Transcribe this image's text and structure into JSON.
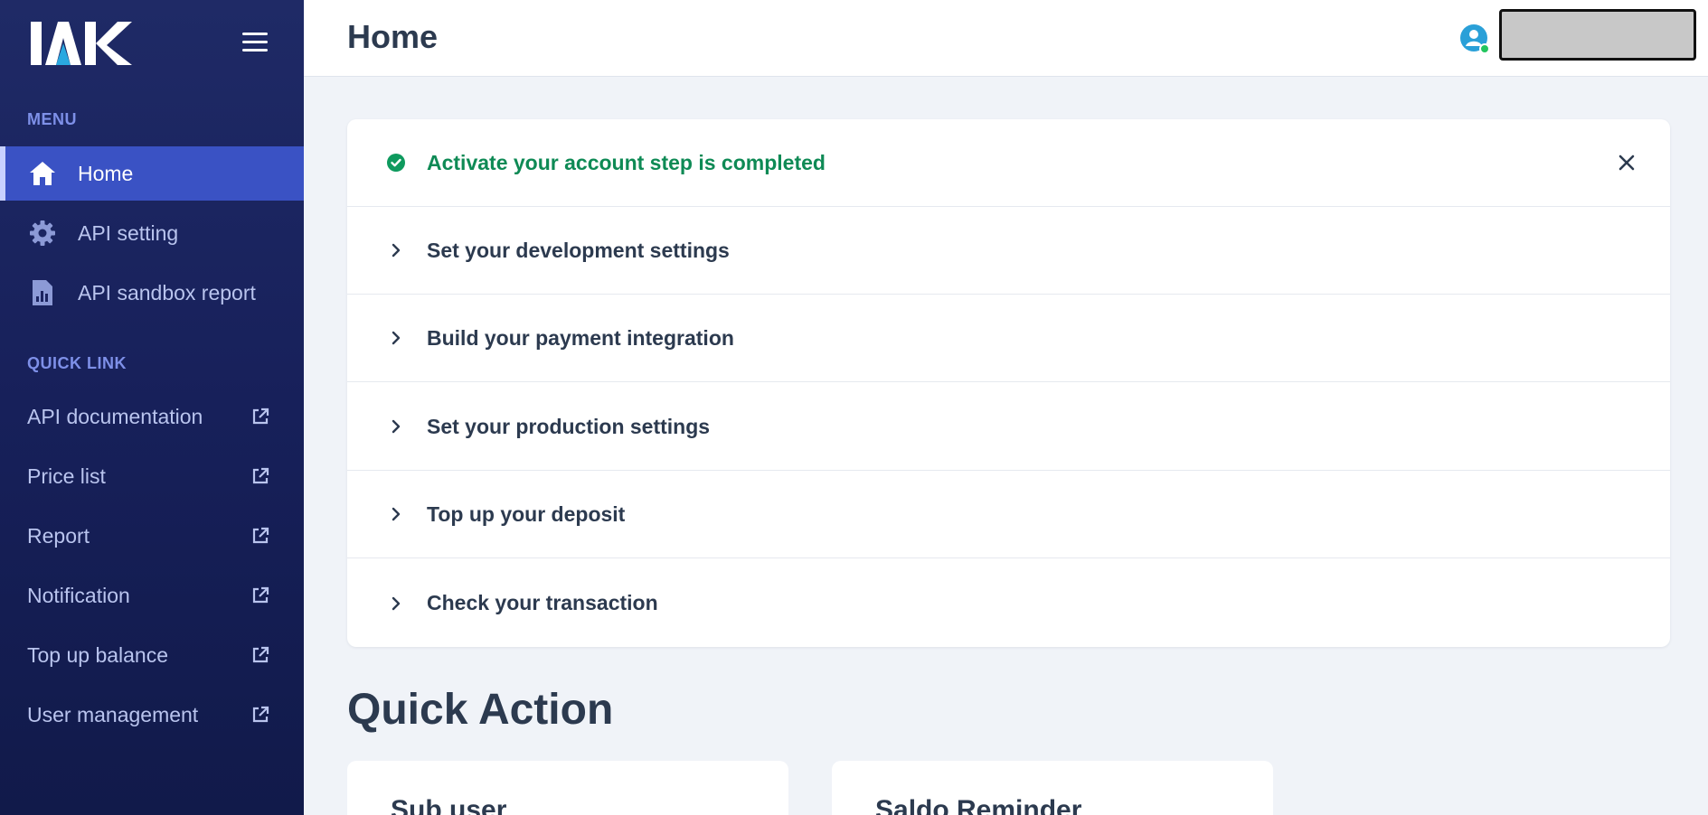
{
  "brand": {
    "logo_text": "IAK"
  },
  "sidebar": {
    "menu_title": "MENU",
    "menu_items": [
      {
        "label": "Home",
        "icon": "home-icon",
        "active": true
      },
      {
        "label": "API setting",
        "icon": "gear-icon",
        "active": false
      },
      {
        "label": "API sandbox report",
        "icon": "report-icon",
        "active": false
      }
    ],
    "quicklink_title": "QUICK LINK",
    "quick_links": [
      {
        "label": "API documentation",
        "icon": "external-link-icon"
      },
      {
        "label": "Price list",
        "icon": "external-link-icon"
      },
      {
        "label": "Report",
        "icon": "external-link-icon"
      },
      {
        "label": "Notification",
        "icon": "external-link-icon"
      },
      {
        "label": "Top up balance",
        "icon": "external-link-icon"
      },
      {
        "label": "User management",
        "icon": "external-link-icon"
      }
    ]
  },
  "header": {
    "title": "Home"
  },
  "checklist": {
    "items": [
      {
        "label": "Activate your account step is completed",
        "status": "completed",
        "icon": "check-circle-icon"
      },
      {
        "label": "Set your development settings",
        "status": "pending",
        "icon": "chevron-right-icon"
      },
      {
        "label": "Build your payment integration",
        "status": "pending",
        "icon": "chevron-right-icon"
      },
      {
        "label": "Set your production settings",
        "status": "pending",
        "icon": "chevron-right-icon"
      },
      {
        "label": "Top up your deposit",
        "status": "pending",
        "icon": "chevron-right-icon"
      },
      {
        "label": "Check your transaction",
        "status": "pending",
        "icon": "chevron-right-icon"
      }
    ]
  },
  "quick_action": {
    "title": "Quick Action",
    "cards": [
      {
        "title": "Sub user"
      },
      {
        "title": "Saldo Reminder"
      }
    ]
  },
  "colors": {
    "sidebar_bg": "#1b2560",
    "active_item": "#3a52c4",
    "section_title": "#7e90e8",
    "success": "#0e8a55",
    "page_bg": "#f0f3f8",
    "text_dark": "#2c3a4f"
  }
}
